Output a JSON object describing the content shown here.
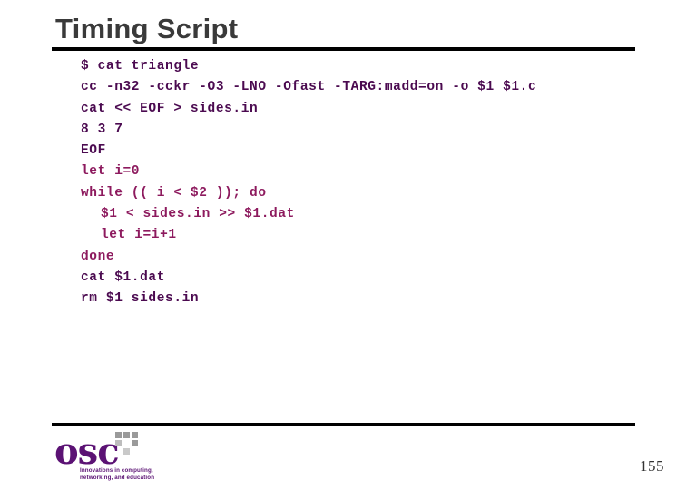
{
  "slide": {
    "title": "Timing Script",
    "page_number": "155",
    "title_color": "#3a3a3a",
    "rule_color": "#000000",
    "background_color": "#ffffff"
  },
  "code": {
    "text_color": "#4b0a50",
    "accent_color": "#8d1a5e",
    "lines": [
      {
        "text": "$ cat triangle",
        "indent": false,
        "accent": false
      },
      {
        "text": "cc -n32 -cckr -O3 -LNO -Ofast -TARG:madd=on -o $1 $1.c",
        "indent": false,
        "accent": false
      },
      {
        "text": "cat << EOF > sides.in",
        "indent": false,
        "accent": false
      },
      {
        "text": "8 3 7",
        "indent": false,
        "accent": false
      },
      {
        "text": "EOF",
        "indent": false,
        "accent": false
      },
      {
        "text": "let i=0",
        "indent": false,
        "accent": true
      },
      {
        "text": "while (( i < $2 )); do",
        "indent": false,
        "accent": true
      },
      {
        "text": "$1 < sides.in >> $1.dat",
        "indent": true,
        "accent": true
      },
      {
        "text": "let i=i+1",
        "indent": true,
        "accent": true
      },
      {
        "text": "done",
        "indent": false,
        "accent": true
      },
      {
        "text": "cat $1.dat",
        "indent": false,
        "accent": false
      },
      {
        "text": "rm $1 sides.in",
        "indent": false,
        "accent": false
      }
    ]
  },
  "logo": {
    "wordmark": "osc",
    "tagline": "Innovations in computing,\nnetworking, and education",
    "wordmark_color": "#5b1274",
    "grid_icon": "pixel-grid-icon"
  }
}
